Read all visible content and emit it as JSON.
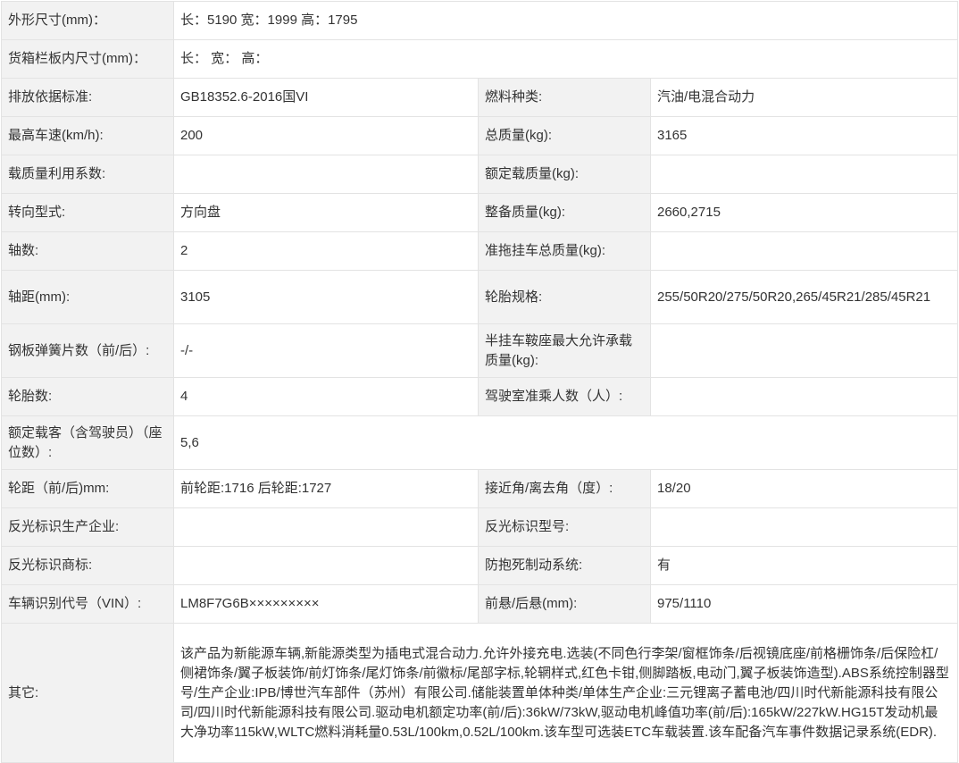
{
  "rows": {
    "r1": {
      "k1": "外形尺寸(mm)：",
      "v1": "长：5190 宽：1999 高：1795"
    },
    "r2": {
      "k1": "货箱栏板内尺寸(mm)：",
      "v1": "长： 宽： 高："
    },
    "r3": {
      "k1": "排放依据标准:",
      "v1": "GB18352.6-2016国VI",
      "k2": "燃料种类:",
      "v2": "汽油/电混合动力"
    },
    "r4": {
      "k1": "最高车速(km/h):",
      "v1": "200",
      "k2": "总质量(kg):",
      "v2": "3165"
    },
    "r5": {
      "k1": "载质量利用系数:",
      "v1": "",
      "k2": "额定载质量(kg):",
      "v2": ""
    },
    "r6": {
      "k1": "转向型式:",
      "v1": "方向盘",
      "k2": "整备质量(kg):",
      "v2": "2660,2715"
    },
    "r7": {
      "k1": "轴数:",
      "v1": "2",
      "k2": "准拖挂车总质量(kg):",
      "v2": ""
    },
    "r8": {
      "k1": "轴距(mm):",
      "v1": "3105",
      "k2": "轮胎规格:",
      "v2": "255/50R20/275/50R20,265/45R21/285/45R21"
    },
    "r9": {
      "k1": "钢板弹簧片数（前/后）:",
      "v1": "-/-",
      "k2": "半挂车鞍座最大允许承载质量(kg):",
      "v2": ""
    },
    "r10": {
      "k1": "轮胎数:",
      "v1": "4",
      "k2": "驾驶室准乘人数（人）:",
      "v2": ""
    },
    "r11": {
      "k1": "额定载客（含驾驶员）（座位数）:",
      "v1": "5,6"
    },
    "r12": {
      "k1": "轮距（前/后)mm:",
      "v1": "前轮距:1716 后轮距:1727",
      "k2": "接近角/离去角（度）:",
      "v2": "18/20"
    },
    "r13": {
      "k1": "反光标识生产企业:",
      "v1": "",
      "k2": "反光标识型号:",
      "v2": ""
    },
    "r14": {
      "k1": "反光标识商标:",
      "v1": "",
      "k2": "防抱死制动系统:",
      "v2": "有"
    },
    "r15": {
      "k1": "车辆识别代号（VIN）:",
      "v1": "LM8F7G6B×××××××××",
      "k2": "前悬/后悬(mm):",
      "v2": "975/1110"
    },
    "r16": {
      "k1": "其它:",
      "v1": "该产品为新能源车辆,新能源类型为插电式混合动力.允许外接充电.选装(不同色行李架/窗框饰条/后视镜底座/前格栅饰条/后保险杠/侧裙饰条/翼子板装饰/前灯饰条/尾灯饰条/前徽标/尾部字标,轮辋样式,红色卡钳,侧脚踏板,电动门,翼子板装饰造型).ABS系统控制器型号/生产企业:IPB/博世汽车部件（苏州）有限公司.储能装置单体种类/单体生产企业:三元锂离子蓄电池/四川时代新能源科技有限公司/四川时代新能源科技有限公司.驱动电机额定功率(前/后):36kW/73kW,驱动电机峰值功率(前/后):165kW/227kW.HG15T发动机最大净功率115kW,WLTC燃料消耗量0.53L/100km,0.52L/100km.该车型可选装ETC车载装置.该车配备汽车事件数据记录系统(EDR)."
    }
  }
}
